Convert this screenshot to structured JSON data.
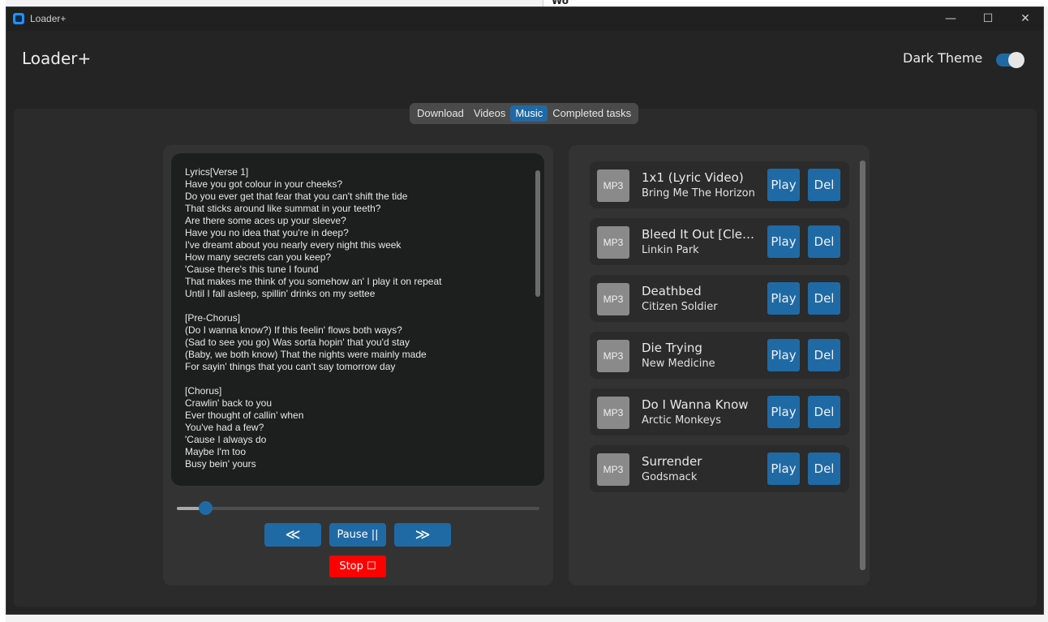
{
  "background": {
    "partial_heading": "Wo"
  },
  "window": {
    "title": "Loader+",
    "minimize_glyph": "—",
    "maximize_glyph": "☐",
    "close_glyph": "✕"
  },
  "header": {
    "app_title": "Loader+",
    "theme_label": "Dark Theme",
    "dark_theme_on": true
  },
  "tabs": [
    {
      "label": "Download",
      "active": false
    },
    {
      "label": "Videos",
      "active": false
    },
    {
      "label": "Music",
      "active": true
    },
    {
      "label": "Completed tasks",
      "active": false
    }
  ],
  "player": {
    "lyrics": "Lyrics[Verse 1]\nHave you got colour in your cheeks?\nDo you ever get that fear that you can't shift the tide\nThat sticks around like summat in your teeth?\nAre there some aces up your sleeve?\nHave you no idea that you're in deep?\nI've dreamt about you nearly every night this week\nHow many secrets can you keep?\n'Cause there's this tune I found\nThat makes me think of you somehow an' I play it on repeat\nUntil I fall asleep, spillin' drinks on my settee\n\n[Pre-Chorus]\n(Do I wanna know?) If this feelin' flows both ways?\n(Sad to see you go) Was sorta hopin' that you'd stay\n(Baby, we both know) That the nights were mainly made\nFor sayin' things that you can't say tomorrow day\n\n[Chorus]\nCrawlin' back to you\nEver thought of callin' when\nYou've had a few?\n'Cause I always do\nMaybe I'm too\nBusy bein' yours",
    "progress_fraction": 0.06,
    "rewind_label": "≪",
    "pause_label": "Pause ||",
    "forward_label": "≫",
    "stop_label": "Stop ☐"
  },
  "songs": [
    {
      "format": "MP3",
      "title": "1x1 (Lyric Video)",
      "artist": "Bring Me The Horizon",
      "play_label": "Play",
      "del_label": "Del"
    },
    {
      "format": "MP3",
      "title": "Bleed It Out [Clean Version]",
      "artist": "Linkin Park",
      "play_label": "Play",
      "del_label": "Del"
    },
    {
      "format": "MP3",
      "title": "Deathbed",
      "artist": "Citizen Soldier",
      "play_label": "Play",
      "del_label": "Del"
    },
    {
      "format": "MP3",
      "title": "Die Trying",
      "artist": "New Medicine",
      "play_label": "Play",
      "del_label": "Del"
    },
    {
      "format": "MP3",
      "title": "Do I Wanna Know",
      "artist": "Arctic Monkeys",
      "play_label": "Play",
      "del_label": "Del"
    },
    {
      "format": "MP3",
      "title": "Surrender",
      "artist": "Godsmack",
      "play_label": "Play",
      "del_label": "Del"
    }
  ],
  "colors": {
    "accent": "#1f6aa5",
    "stop": "#ff0000",
    "window_bg": "#242424",
    "panel_bg": "#333333"
  }
}
